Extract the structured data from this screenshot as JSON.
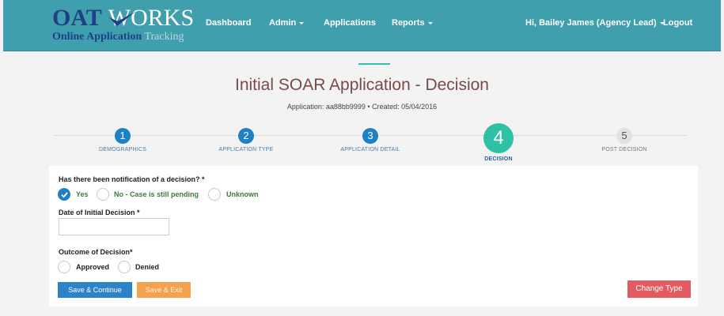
{
  "brand": {
    "oat": "OAT",
    "works": "WORKS",
    "line2a": "Online Application",
    "line2b": "Tracking"
  },
  "nav": {
    "dashboard": "Dashboard",
    "admin": "Admin",
    "applications": "Applications",
    "reports": "Reports",
    "user": "Hi, Bailey James (Agency Lead)",
    "logout": "Logout"
  },
  "page": {
    "title": "Initial SOAR Application - Decision",
    "subtitle": "Application: aa88bb9999 • Created: 05/04/2016"
  },
  "steps": [
    {
      "number": "1",
      "label": "DEMOGRAPHICS"
    },
    {
      "number": "2",
      "label": "APPLICATION TYPE"
    },
    {
      "number": "3",
      "label": "APPLICATION DETAIL"
    },
    {
      "number": "4",
      "label": "DECISION"
    },
    {
      "number": "5",
      "label": "POST DECISION"
    }
  ],
  "form": {
    "q1": "Has there been notification of a decision? *",
    "q1_options": [
      "Yes",
      "No - Case is still pending",
      "Unknown"
    ],
    "q1_selected": "Yes",
    "date_label": "Date of Initial Decision *",
    "date_value": "",
    "q2": "Outcome of Decision*",
    "q2_options": [
      "Approved",
      "Denied"
    ]
  },
  "buttons": {
    "save_continue": "Save & Continue",
    "save_exit": "Save & Exit",
    "change_type": "Change Type"
  },
  "colors": {
    "nav": "#3f9fad",
    "primary": "#2c83c7",
    "warning": "#f4a24d",
    "danger": "#e25b61",
    "active_step": "#2fc1a6"
  },
  "icons": {
    "logo_check": "check-swoosh-icon",
    "calendar": "calendar-icon",
    "selected_radio": "check-icon",
    "dropdown": "caret-down-icon"
  }
}
